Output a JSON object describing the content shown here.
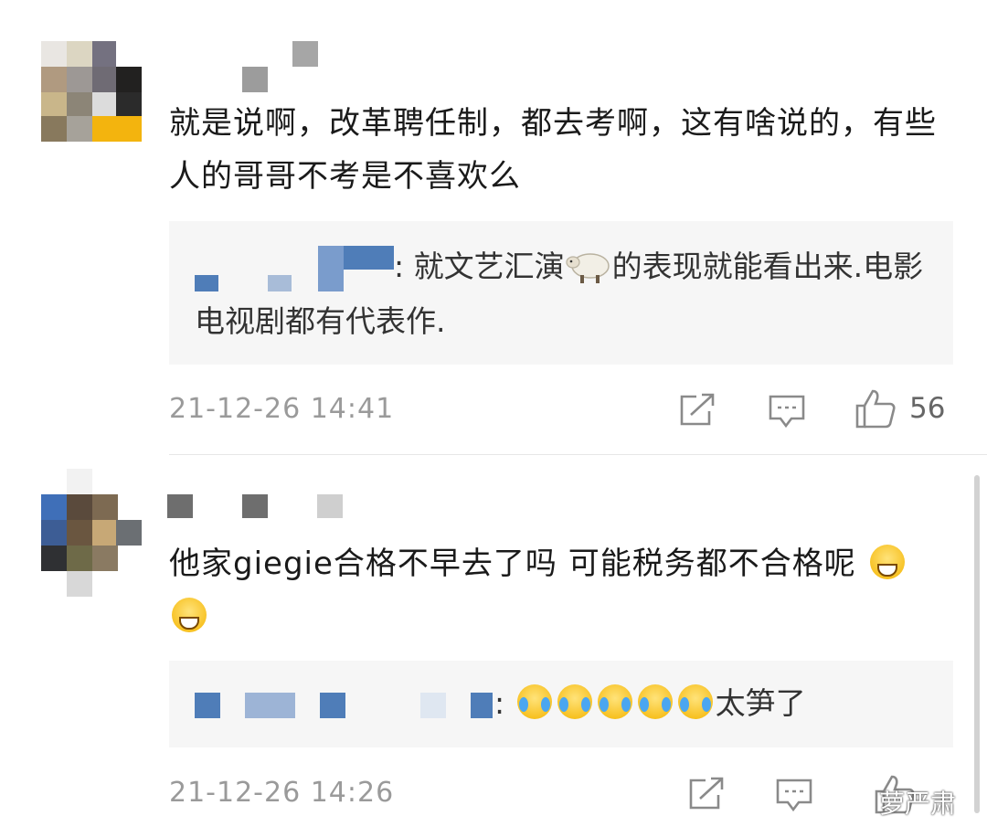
{
  "comments": [
    {
      "text": "就是说啊，改革聘任制，都去考啊，这有啥说的，有些人的哥哥不考是不喜欢么",
      "reply": {
        "after_emoji": "的表现就能看出来.电影电视剧都有代表作.",
        "before_emoji": ": 就文艺汇演",
        "emoji": "sheep-emoji"
      },
      "timestamp": "21-12-26 14:41",
      "share_icon": "share-icon",
      "reply_icon": "comment-icon",
      "like_icon": "thumbs-up-icon",
      "like_count": "56"
    },
    {
      "text": "他家giegie合格不早去了吗 可能税务都不合格呢",
      "text_emojis": [
        "grin-emoji",
        "grin-emoji"
      ],
      "reply": {
        "before_emoji": ":",
        "emojis": [
          "cry-laugh-emoji",
          "cry-laugh-emoji",
          "cry-laugh-emoji",
          "cry-laugh-emoji",
          "cry-laugh-emoji"
        ],
        "after_emoji": "太笋了"
      },
      "timestamp": "21-12-26 14:26",
      "share_icon": "share-icon",
      "reply_icon": "comment-icon",
      "like_icon": "thumbs-up-icon"
    }
  ],
  "watermark": {
    "text": "萝严肃",
    "icon": "wechat-icon"
  },
  "colors": {
    "text": "#1a1a1a",
    "muted": "#9a9a9a",
    "reply_bg": "#f6f6f6",
    "mosaic_blue": "#4f7db8"
  }
}
